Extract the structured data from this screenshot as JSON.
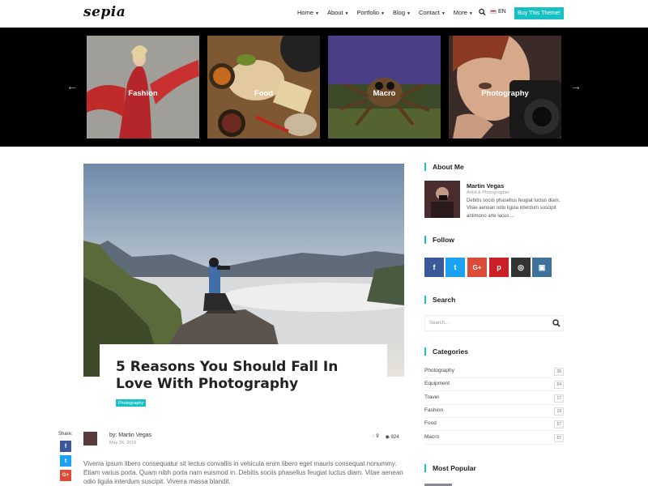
{
  "header": {
    "logo": "sepia",
    "nav": [
      "Home",
      "About",
      "Portfolio",
      "Blog",
      "Contact",
      "More"
    ],
    "lang": "EN",
    "buy_label": "Buy This Theme!"
  },
  "slider": {
    "slides": [
      "Fashion",
      "Food",
      "Macro",
      "Photography"
    ],
    "prev_icon": "←",
    "next_icon": "→"
  },
  "post": {
    "title_line1": "5 Reasons You Should Fall In",
    "title_line2": "Love With Photography",
    "tag": "Photography",
    "share_label": "Share:",
    "share": [
      "f",
      "t",
      "G+"
    ],
    "author": "by: Martin Vegas",
    "date": "May 26, 2016",
    "comments": "9",
    "views": "924",
    "excerpt": "Viverra ipsum libero consequatur sit lectus convallis in vehicula enim libero eget mauris consequat nonummy. Etiam varius porta. Quam nibh porta nam euismod in. Debitis sociis phasellus feugiat luctus diam. Vitae aenean odio ligula interdum suscipit. Viverra massa blandit."
  },
  "sidebar": {
    "about_title": "About Me",
    "about_name": "Martin Vegas",
    "about_role": "Artist & Photographer",
    "about_text": "Debitis sociis phasellus feugiat luctus diam. Vitae aenean odio ligula interdum suscipit antimono arte lacus ...",
    "follow_title": "Follow",
    "social": [
      {
        "icon": "f",
        "color": "#3b5998"
      },
      {
        "icon": "t",
        "color": "#1da1f2"
      },
      {
        "icon": "G+",
        "color": "#dd4b39"
      },
      {
        "icon": "p",
        "color": "#cb2027"
      },
      {
        "icon": "◎",
        "color": "#333333"
      },
      {
        "icon": "▣",
        "color": "#3f729b"
      }
    ],
    "search_title": "Search",
    "search_placeholder": "Search...",
    "categories_title": "Categories",
    "categories": [
      {
        "name": "Photography",
        "count": "26"
      },
      {
        "name": "Equipment",
        "count": "54"
      },
      {
        "name": "Travel",
        "count": "17"
      },
      {
        "name": "Fashion",
        "count": "19"
      },
      {
        "name": "Food",
        "count": "57"
      },
      {
        "name": "Macro",
        "count": "57"
      }
    ],
    "popular_title": "Most Popular"
  },
  "colors": {
    "accent": "#16c0c3"
  }
}
